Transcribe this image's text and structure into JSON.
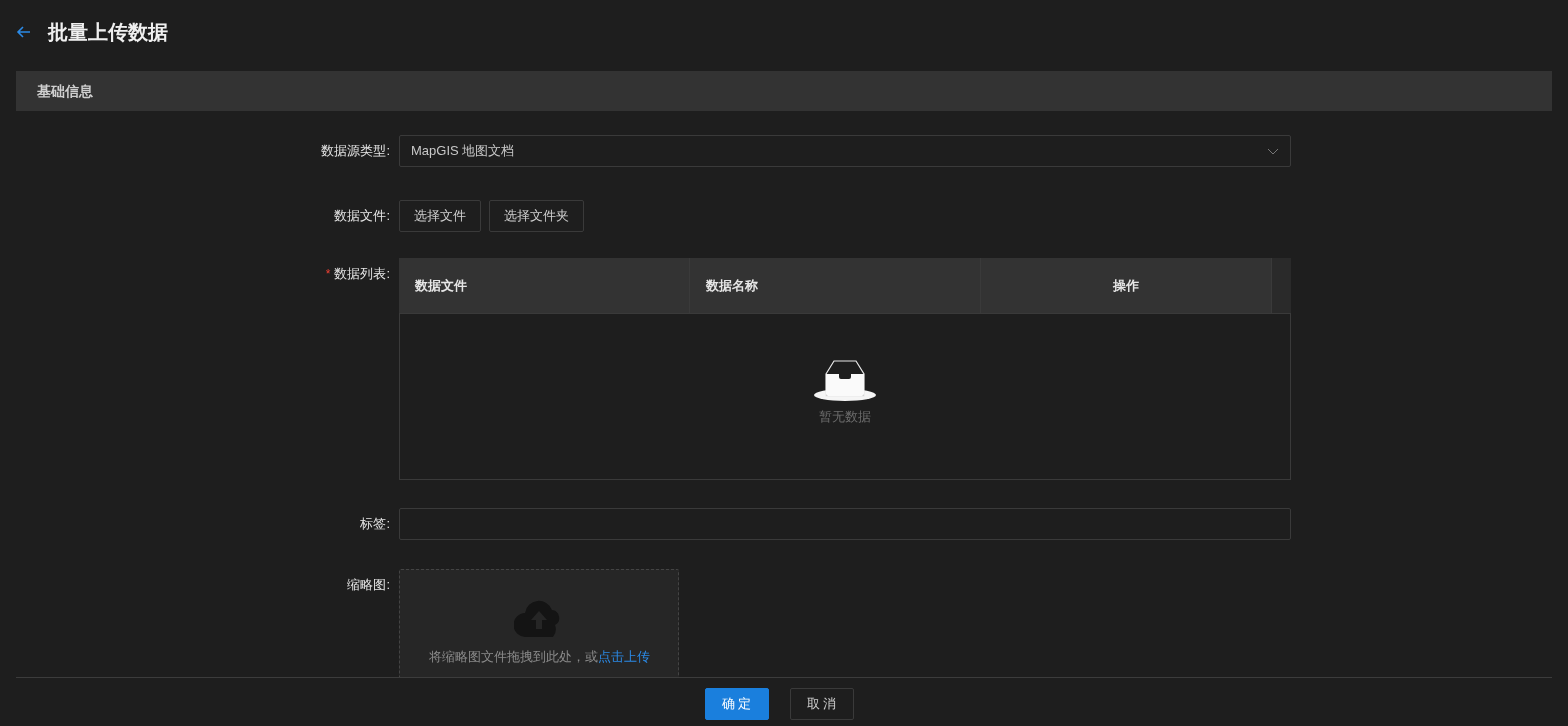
{
  "page": {
    "title": "批量上传数据"
  },
  "section": {
    "title": "基础信息"
  },
  "fields": [
    {
      "kind": "select",
      "label": "数据源类型:",
      "value": "MapGIS 地图文档"
    },
    {
      "kind": "buttons",
      "label": "数据文件:",
      "buttons": [
        "选择文件",
        "选择文件夹"
      ]
    },
    {
      "kind": "table",
      "label": "数据列表:",
      "required_mark": "*",
      "columns": [
        "数据文件",
        "数据名称",
        "操作"
      ],
      "empty_text": "暂无数据"
    },
    {
      "kind": "text",
      "label": "标签:"
    },
    {
      "kind": "upload",
      "label": "缩略图:",
      "hint": "将缩略图文件拖拽到此处，或",
      "link": "点击上传"
    }
  ],
  "footer": {
    "buttons": [
      {
        "label": "确 定",
        "kind": "primary"
      },
      {
        "label": "取 消",
        "kind": "default"
      }
    ]
  }
}
